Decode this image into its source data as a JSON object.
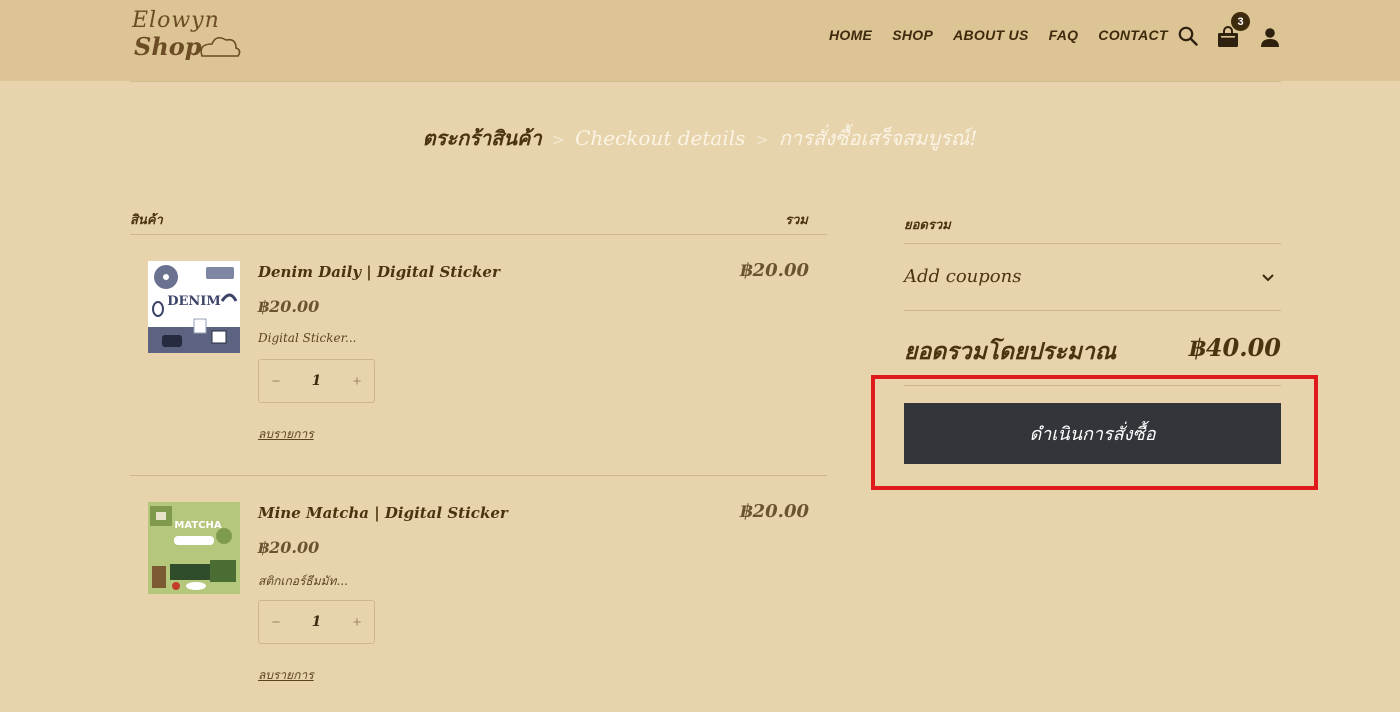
{
  "header": {
    "logo": {
      "line1": "Elowyn",
      "line2": "Shop"
    },
    "nav": [
      "HOME",
      "SHOP",
      "ABOUT US",
      "FAQ",
      "CONTACT"
    ],
    "cart_count": "3",
    "icons": [
      "search-icon",
      "bag-icon",
      "user-icon"
    ]
  },
  "breadcrumb": {
    "steps": [
      "ตระกร้าสินค้า",
      "Checkout details",
      "การสั่งซื้อเสร็จสมบูรณ์!"
    ],
    "separator": ">"
  },
  "cart": {
    "col_product": "สินค้า",
    "col_total": "รวม",
    "items": [
      {
        "name": "Denim Daily | Digital Sticker",
        "price": "฿20.00",
        "desc": "Digital Sticker...",
        "qty": "1",
        "minus": "−",
        "plus": "+",
        "remove": "ลบรายการ",
        "line_total": "฿20.00",
        "thumb_text": "DENIM"
      },
      {
        "name": "Mine Matcha | Digital Sticker",
        "price": "฿20.00",
        "desc": "สติกเกอร์ธีมมัท...",
        "qty": "1",
        "minus": "−",
        "plus": "+",
        "remove": "ลบรายการ",
        "line_total": "฿20.00",
        "thumb_text": "MATCHA"
      }
    ]
  },
  "summary": {
    "heading": "ยอดรวม",
    "coupon_label": "Add coupons",
    "total_label": "ยอดรวมโดยประมาณ",
    "total_value": "฿40.00",
    "checkout_label": "ดำเนินการสั่งซื้อ"
  },
  "colors": {
    "page_bg": "#e7d4ad",
    "header_bg": "#dcc494",
    "button_bg": "#32363b",
    "highlight": "#e0191b",
    "text": "#4a3410"
  }
}
